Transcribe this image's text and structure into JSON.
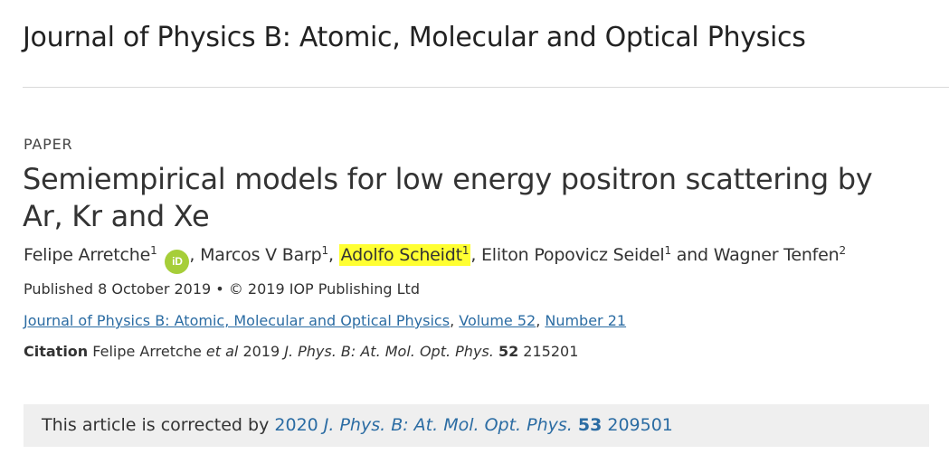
{
  "journal": {
    "title": "Journal of Physics B: Atomic, Molecular and Optical Physics"
  },
  "article": {
    "type": "PAPER",
    "title": "Semiempirical models for low energy positron scattering by Ar, Kr and Xe",
    "authors": [
      {
        "name": "Felipe Arretche",
        "affil": "1",
        "orcid": true
      },
      {
        "name": "Marcos V Barp",
        "affil": "1"
      },
      {
        "name": "Adolfo Scheidt",
        "affil": "1",
        "highlighted": true
      },
      {
        "name": "Eliton Popovicz Seidel",
        "affil": "1"
      },
      {
        "name": "Wagner Tenfen",
        "affil": "2"
      }
    ],
    "author_sep_comma": ", ",
    "author_sep_and": " and ",
    "orcid_label": "iD",
    "published": "Published 8 October 2019 • © 2019 IOP Publishing Ltd"
  },
  "links": {
    "journal": "Journal of Physics B: Atomic, Molecular and Optical Physics",
    "volume": "Volume 52",
    "number": "Number 21",
    "sep": ", "
  },
  "citation": {
    "label": "Citation",
    "authors": "Felipe Arretche",
    "etal": "et al",
    "year": "2019",
    "journal_abbrev": "J. Phys. B: At. Mol. Opt. Phys.",
    "volume": "52",
    "article_number": "215201"
  },
  "correction": {
    "prefix": "This article is corrected by",
    "year": "2020",
    "journal_abbrev": "J. Phys. B: At. Mol. Opt. Phys.",
    "volume": "53",
    "article_number": "209501"
  }
}
